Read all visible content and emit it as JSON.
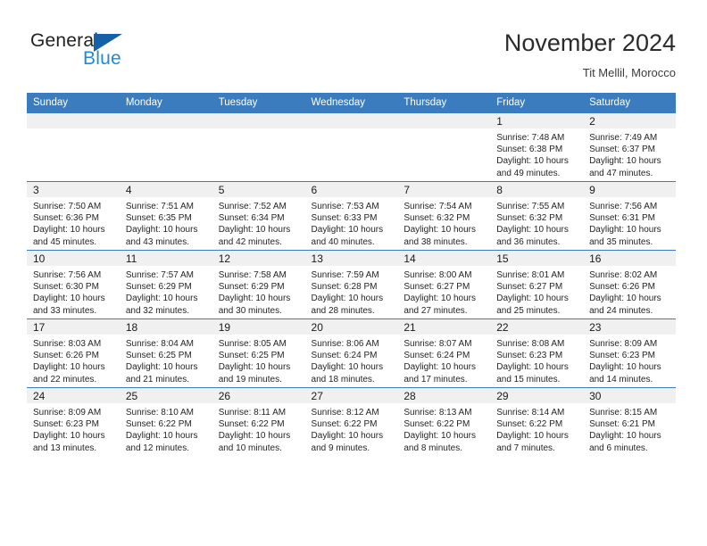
{
  "brand": {
    "name_part1": "General",
    "name_part2": "Blue",
    "triangle_icon": "triangle-logo-icon",
    "accent_color": "#2489ce",
    "dark_color": "#1461a8"
  },
  "header": {
    "title": "November 2024",
    "subtitle": "Tit Mellil, Morocco"
  },
  "colors": {
    "header_row_bg": "#3a7cbe",
    "daynum_band_bg": "#f0f0f0",
    "grid_line": "#3a7cbe"
  },
  "weekday_headers": [
    "Sunday",
    "Monday",
    "Tuesday",
    "Wednesday",
    "Thursday",
    "Friday",
    "Saturday"
  ],
  "weeks": [
    [
      {
        "day": "",
        "sunrise": "",
        "sunset": "",
        "daylight1": "",
        "daylight2": "",
        "empty": true
      },
      {
        "day": "",
        "sunrise": "",
        "sunset": "",
        "daylight1": "",
        "daylight2": "",
        "empty": true
      },
      {
        "day": "",
        "sunrise": "",
        "sunset": "",
        "daylight1": "",
        "daylight2": "",
        "empty": true
      },
      {
        "day": "",
        "sunrise": "",
        "sunset": "",
        "daylight1": "",
        "daylight2": "",
        "empty": true
      },
      {
        "day": "",
        "sunrise": "",
        "sunset": "",
        "daylight1": "",
        "daylight2": "",
        "empty": true
      },
      {
        "day": "1",
        "sunrise": "Sunrise: 7:48 AM",
        "sunset": "Sunset: 6:38 PM",
        "daylight1": "Daylight: 10 hours",
        "daylight2": "and 49 minutes."
      },
      {
        "day": "2",
        "sunrise": "Sunrise: 7:49 AM",
        "sunset": "Sunset: 6:37 PM",
        "daylight1": "Daylight: 10 hours",
        "daylight2": "and 47 minutes."
      }
    ],
    [
      {
        "day": "3",
        "sunrise": "Sunrise: 7:50 AM",
        "sunset": "Sunset: 6:36 PM",
        "daylight1": "Daylight: 10 hours",
        "daylight2": "and 45 minutes."
      },
      {
        "day": "4",
        "sunrise": "Sunrise: 7:51 AM",
        "sunset": "Sunset: 6:35 PM",
        "daylight1": "Daylight: 10 hours",
        "daylight2": "and 43 minutes."
      },
      {
        "day": "5",
        "sunrise": "Sunrise: 7:52 AM",
        "sunset": "Sunset: 6:34 PM",
        "daylight1": "Daylight: 10 hours",
        "daylight2": "and 42 minutes."
      },
      {
        "day": "6",
        "sunrise": "Sunrise: 7:53 AM",
        "sunset": "Sunset: 6:33 PM",
        "daylight1": "Daylight: 10 hours",
        "daylight2": "and 40 minutes."
      },
      {
        "day": "7",
        "sunrise": "Sunrise: 7:54 AM",
        "sunset": "Sunset: 6:32 PM",
        "daylight1": "Daylight: 10 hours",
        "daylight2": "and 38 minutes."
      },
      {
        "day": "8",
        "sunrise": "Sunrise: 7:55 AM",
        "sunset": "Sunset: 6:32 PM",
        "daylight1": "Daylight: 10 hours",
        "daylight2": "and 36 minutes."
      },
      {
        "day": "9",
        "sunrise": "Sunrise: 7:56 AM",
        "sunset": "Sunset: 6:31 PM",
        "daylight1": "Daylight: 10 hours",
        "daylight2": "and 35 minutes."
      }
    ],
    [
      {
        "day": "10",
        "sunrise": "Sunrise: 7:56 AM",
        "sunset": "Sunset: 6:30 PM",
        "daylight1": "Daylight: 10 hours",
        "daylight2": "and 33 minutes."
      },
      {
        "day": "11",
        "sunrise": "Sunrise: 7:57 AM",
        "sunset": "Sunset: 6:29 PM",
        "daylight1": "Daylight: 10 hours",
        "daylight2": "and 32 minutes."
      },
      {
        "day": "12",
        "sunrise": "Sunrise: 7:58 AM",
        "sunset": "Sunset: 6:29 PM",
        "daylight1": "Daylight: 10 hours",
        "daylight2": "and 30 minutes."
      },
      {
        "day": "13",
        "sunrise": "Sunrise: 7:59 AM",
        "sunset": "Sunset: 6:28 PM",
        "daylight1": "Daylight: 10 hours",
        "daylight2": "and 28 minutes."
      },
      {
        "day": "14",
        "sunrise": "Sunrise: 8:00 AM",
        "sunset": "Sunset: 6:27 PM",
        "daylight1": "Daylight: 10 hours",
        "daylight2": "and 27 minutes."
      },
      {
        "day": "15",
        "sunrise": "Sunrise: 8:01 AM",
        "sunset": "Sunset: 6:27 PM",
        "daylight1": "Daylight: 10 hours",
        "daylight2": "and 25 minutes."
      },
      {
        "day": "16",
        "sunrise": "Sunrise: 8:02 AM",
        "sunset": "Sunset: 6:26 PM",
        "daylight1": "Daylight: 10 hours",
        "daylight2": "and 24 minutes."
      }
    ],
    [
      {
        "day": "17",
        "sunrise": "Sunrise: 8:03 AM",
        "sunset": "Sunset: 6:26 PM",
        "daylight1": "Daylight: 10 hours",
        "daylight2": "and 22 minutes."
      },
      {
        "day": "18",
        "sunrise": "Sunrise: 8:04 AM",
        "sunset": "Sunset: 6:25 PM",
        "daylight1": "Daylight: 10 hours",
        "daylight2": "and 21 minutes."
      },
      {
        "day": "19",
        "sunrise": "Sunrise: 8:05 AM",
        "sunset": "Sunset: 6:25 PM",
        "daylight1": "Daylight: 10 hours",
        "daylight2": "and 19 minutes."
      },
      {
        "day": "20",
        "sunrise": "Sunrise: 8:06 AM",
        "sunset": "Sunset: 6:24 PM",
        "daylight1": "Daylight: 10 hours",
        "daylight2": "and 18 minutes."
      },
      {
        "day": "21",
        "sunrise": "Sunrise: 8:07 AM",
        "sunset": "Sunset: 6:24 PM",
        "daylight1": "Daylight: 10 hours",
        "daylight2": "and 17 minutes."
      },
      {
        "day": "22",
        "sunrise": "Sunrise: 8:08 AM",
        "sunset": "Sunset: 6:23 PM",
        "daylight1": "Daylight: 10 hours",
        "daylight2": "and 15 minutes."
      },
      {
        "day": "23",
        "sunrise": "Sunrise: 8:09 AM",
        "sunset": "Sunset: 6:23 PM",
        "daylight1": "Daylight: 10 hours",
        "daylight2": "and 14 minutes."
      }
    ],
    [
      {
        "day": "24",
        "sunrise": "Sunrise: 8:09 AM",
        "sunset": "Sunset: 6:23 PM",
        "daylight1": "Daylight: 10 hours",
        "daylight2": "and 13 minutes."
      },
      {
        "day": "25",
        "sunrise": "Sunrise: 8:10 AM",
        "sunset": "Sunset: 6:22 PM",
        "daylight1": "Daylight: 10 hours",
        "daylight2": "and 12 minutes."
      },
      {
        "day": "26",
        "sunrise": "Sunrise: 8:11 AM",
        "sunset": "Sunset: 6:22 PM",
        "daylight1": "Daylight: 10 hours",
        "daylight2": "and 10 minutes."
      },
      {
        "day": "27",
        "sunrise": "Sunrise: 8:12 AM",
        "sunset": "Sunset: 6:22 PM",
        "daylight1": "Daylight: 10 hours",
        "daylight2": "and 9 minutes."
      },
      {
        "day": "28",
        "sunrise": "Sunrise: 8:13 AM",
        "sunset": "Sunset: 6:22 PM",
        "daylight1": "Daylight: 10 hours",
        "daylight2": "and 8 minutes."
      },
      {
        "day": "29",
        "sunrise": "Sunrise: 8:14 AM",
        "sunset": "Sunset: 6:22 PM",
        "daylight1": "Daylight: 10 hours",
        "daylight2": "and 7 minutes."
      },
      {
        "day": "30",
        "sunrise": "Sunrise: 8:15 AM",
        "sunset": "Sunset: 6:21 PM",
        "daylight1": "Daylight: 10 hours",
        "daylight2": "and 6 minutes."
      }
    ]
  ]
}
